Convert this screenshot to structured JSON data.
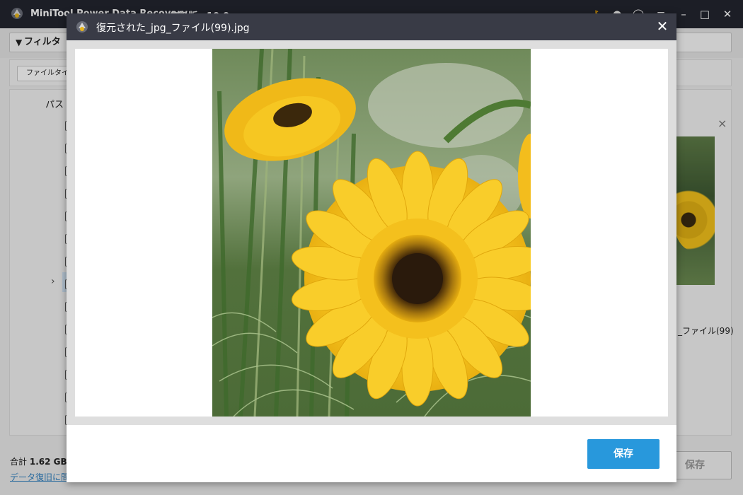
{
  "app": {
    "title": "MiniTool Power Data Recovery",
    "edition": "無料版 v10.0"
  },
  "toolbar": {
    "filter_label": "フィルタ"
  },
  "filter_row": {
    "file_type_label": "ファイルタイプ"
  },
  "tree": {
    "path_label": "パス"
  },
  "preview_panel": {
    "caption": "_ファイル(99)"
  },
  "bottom": {
    "total_prefix": "合計",
    "total_size": "1.62 GB /",
    "help_link": "データ復旧に問題",
    "save_label": "保存"
  },
  "dialog": {
    "title": "復元された_jpg_ファイル(99).jpg",
    "close_icon": "close-icon",
    "save_label": "保存"
  },
  "colors": {
    "titlebar": "#23252f",
    "dialog_header": "#393b46",
    "save_button": "#2898dc",
    "flower_yellow": "#f4c01d",
    "flower_center": "#2a1a0c"
  }
}
